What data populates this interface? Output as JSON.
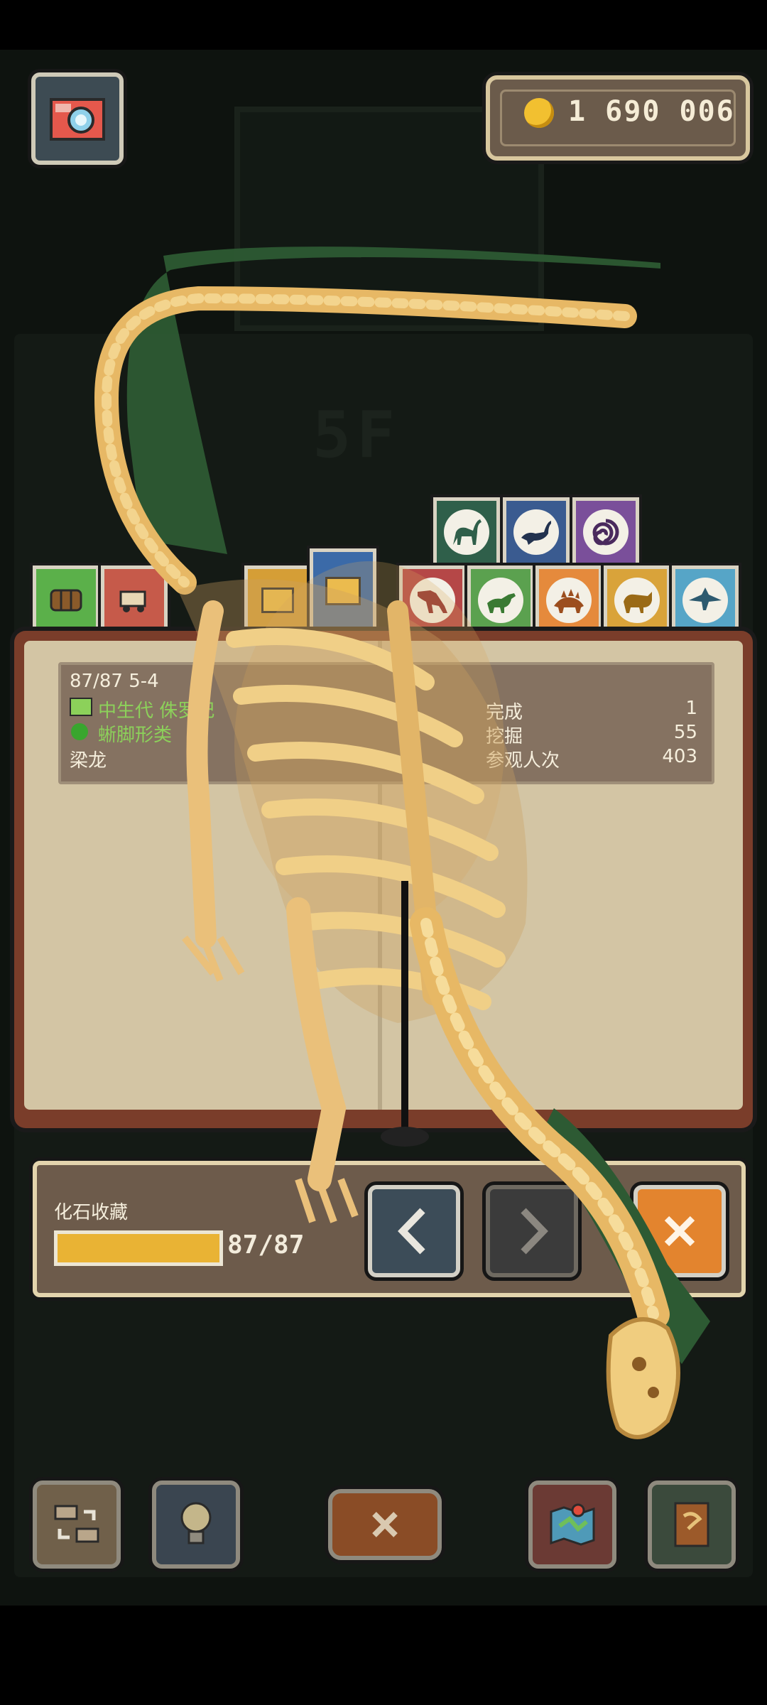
{
  "coins": {
    "value": "1 690 006",
    "icon": "gold-coin-icon"
  },
  "background": {
    "floor_label": "5F"
  },
  "categories": {
    "row_top": [
      {
        "icon": "sauropod-icon",
        "color": "#2f5f4a"
      },
      {
        "icon": "plesiosaur-icon",
        "color": "#3a5b90"
      },
      {
        "icon": "ammonite-icon",
        "color": "#7a4f9a"
      }
    ],
    "row_bottom": [
      {
        "icon": "barrel-icon",
        "color": "#5bb04a"
      },
      {
        "icon": "carriage-icon",
        "color": "#c65a4a"
      },
      {
        "icon": "yellow-card-icon",
        "color": "#d59e36"
      },
      {
        "icon": "selected-card-icon",
        "color": "#3b6aa8"
      },
      {
        "icon": "theropod-icon",
        "color": "#b54747"
      },
      {
        "icon": "ornithopod-icon",
        "color": "#5ba14f"
      },
      {
        "icon": "stegosaur-icon",
        "color": "#e58a3c"
      },
      {
        "icon": "ceratopsian-icon",
        "color": "#d9a33a"
      },
      {
        "icon": "pterosaur-icon",
        "color": "#56a5c7"
      }
    ]
  },
  "info": {
    "index": "87/87 5-4",
    "era": "中生代 侏罗纪",
    "group": "蜥脚形类",
    "name": "梁龙",
    "stats": [
      {
        "label": "完成",
        "value": "1"
      },
      {
        "label": "挖掘",
        "value": "55"
      },
      {
        "label": "参观人次",
        "value": "403"
      }
    ]
  },
  "collection": {
    "label": "化石收藏",
    "progress": 1.0,
    "progress_text": "87/87"
  },
  "toolbar": [
    {
      "icon": "swap-icon"
    },
    {
      "icon": "lightbulb-icon"
    },
    {
      "icon": "close-icon"
    },
    {
      "icon": "map-icon"
    },
    {
      "icon": "book-icon"
    }
  ],
  "colors": {
    "accent_orange": "#e3842e",
    "progress_fill": "#e9b334",
    "green_text": "#8cd15a"
  }
}
